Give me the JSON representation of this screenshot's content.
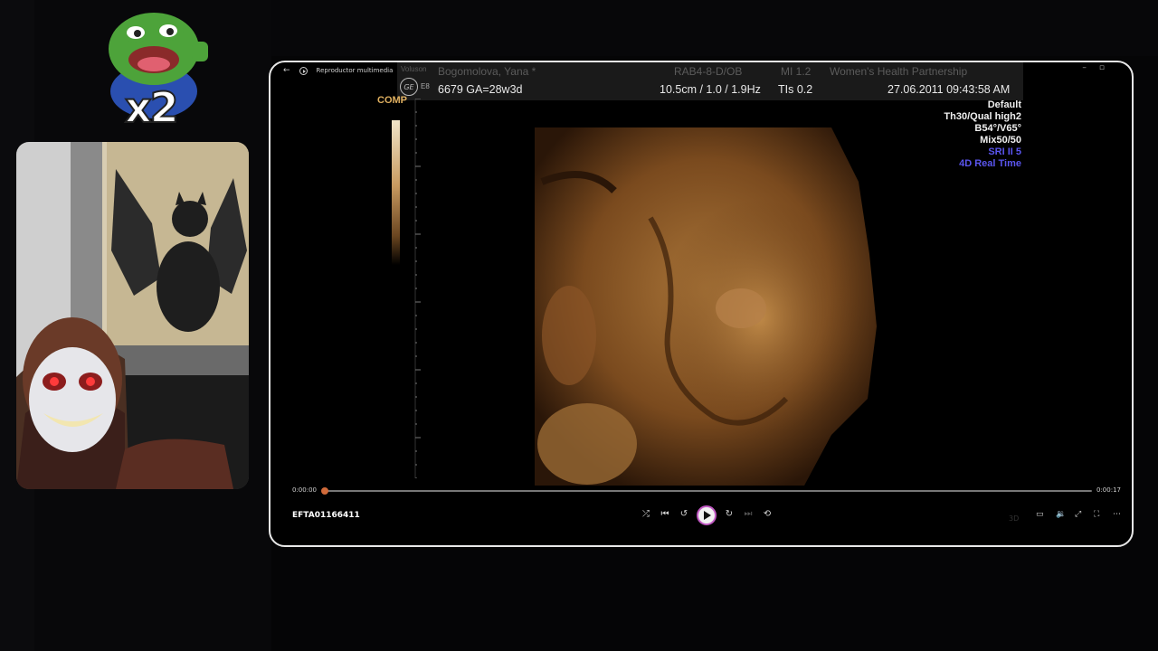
{
  "emote": {
    "label": "x2"
  },
  "player": {
    "app_title": "Reproductor multimedia",
    "filename": "EFTA01166411",
    "time_current": "0:00:00",
    "time_total": "0:00:17",
    "progress": 0.0
  },
  "ultrasound": {
    "brand": "Voluson",
    "model_badge": "E8",
    "patient": "Bogomolova, Yana *",
    "probe": "RAB4-8-D/OB",
    "mi": "MI  1.2",
    "clinic": "Women's Health Partnership",
    "study": "6679  GA=28w3d",
    "depth": "10.5cm / 1.0 / 1.9Hz",
    "tis": "TIs  0.2",
    "datetime": "27.06.2011  09:43:58 AM",
    "comp_label": "COMP",
    "settings": [
      "Default",
      "Th30/Qual high2",
      "B54°/V65°",
      "Mix50/50"
    ],
    "settings_blue": [
      "SRI II 5",
      "4D Real Time"
    ]
  },
  "colors": {
    "accent_play": "#c25ac4",
    "seek_thumb": "#d06a3a",
    "mode_text": "#5a55ee",
    "render_tone": "#a06a30"
  }
}
